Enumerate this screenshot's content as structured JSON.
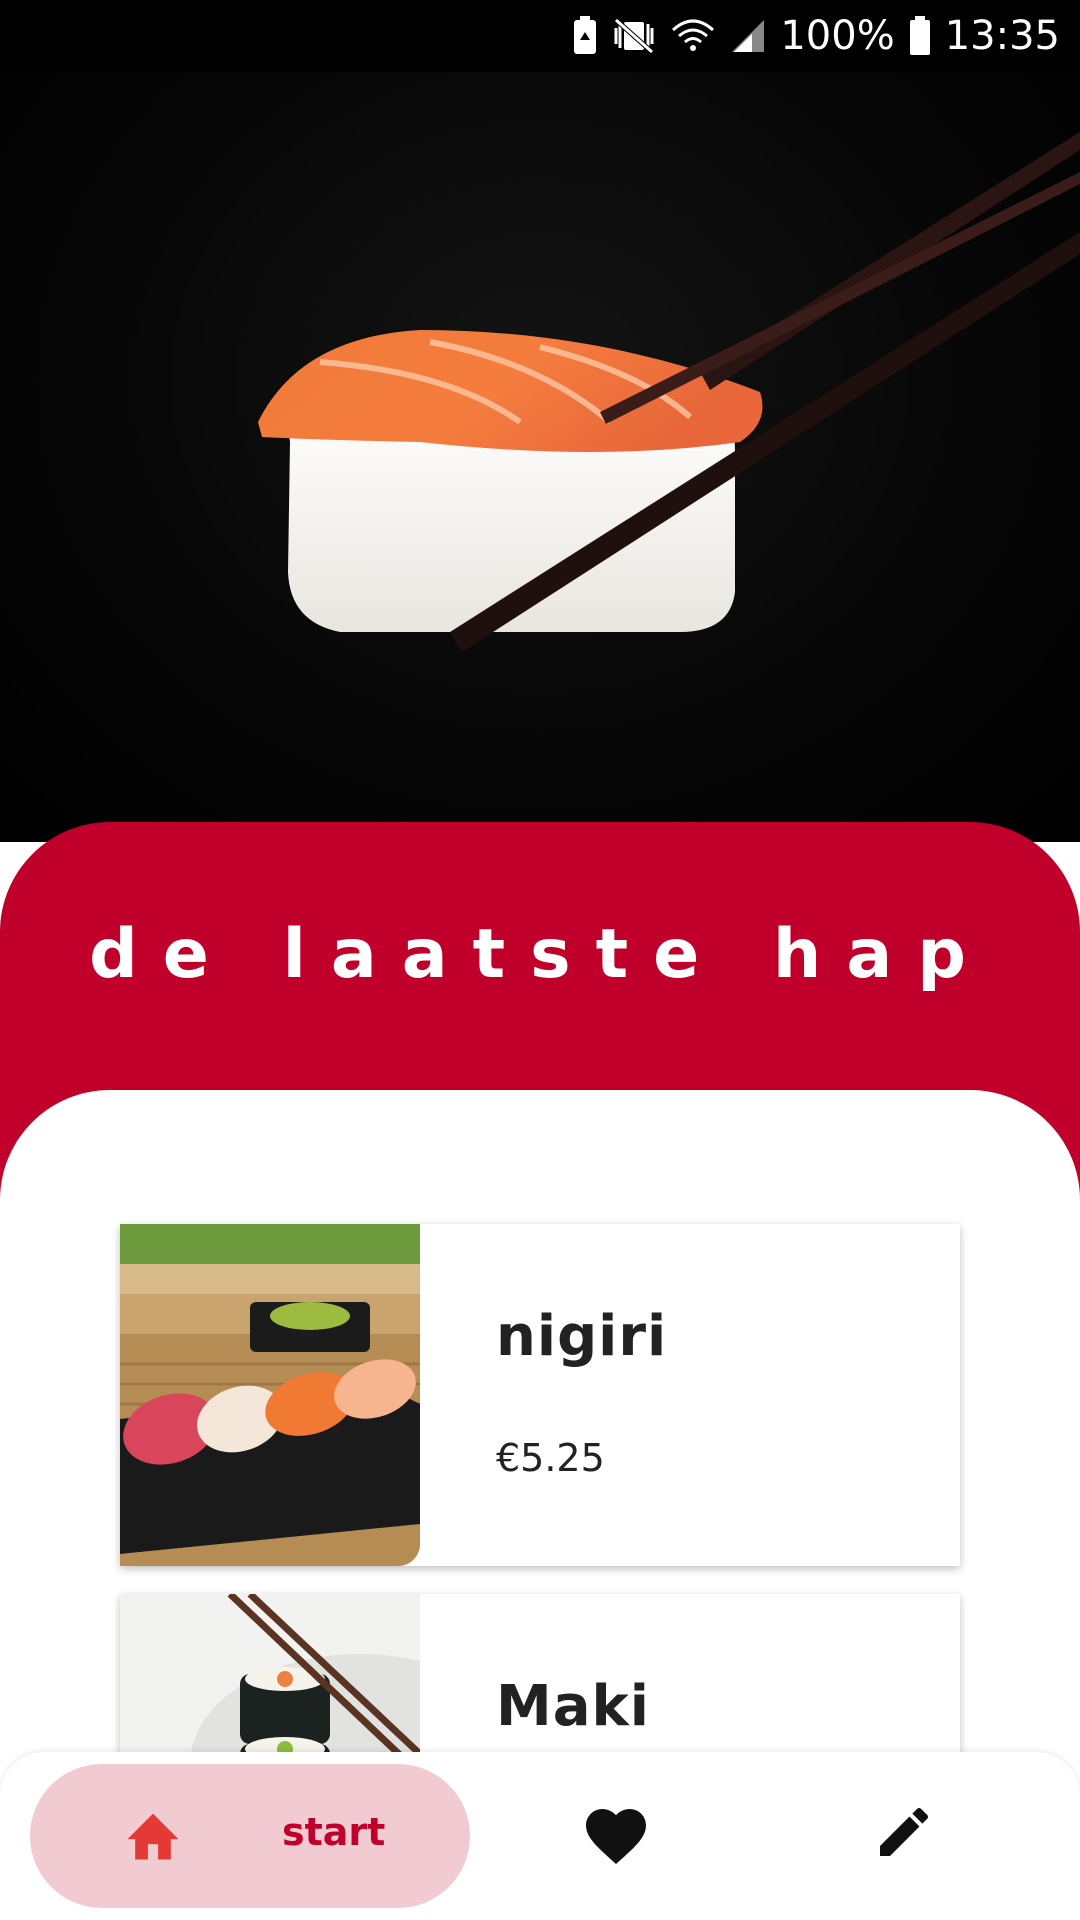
{
  "status_bar": {
    "battery_percent": "100%",
    "time": "13:35",
    "icons": [
      "battery-saver-icon",
      "vibrate-icon",
      "wifi-icon",
      "signal-icon",
      "battery-icon"
    ]
  },
  "hero": {
    "image": "salmon-nigiri-with-chopsticks"
  },
  "header": {
    "title": "de laatste hap"
  },
  "menu": {
    "items": [
      {
        "name": "nigiri",
        "price": "€5.25",
        "image": "nigiri-platter"
      },
      {
        "name": "Maki",
        "price": "",
        "image": "maki-rolls"
      }
    ]
  },
  "bottom_nav": {
    "start_label": "start",
    "icons": [
      "home-icon",
      "heart-icon",
      "pencil-icon"
    ]
  },
  "colors": {
    "brand_red": "#c0002a",
    "active_tab_bg": "#f2cbd2",
    "text_dark": "#222222"
  }
}
